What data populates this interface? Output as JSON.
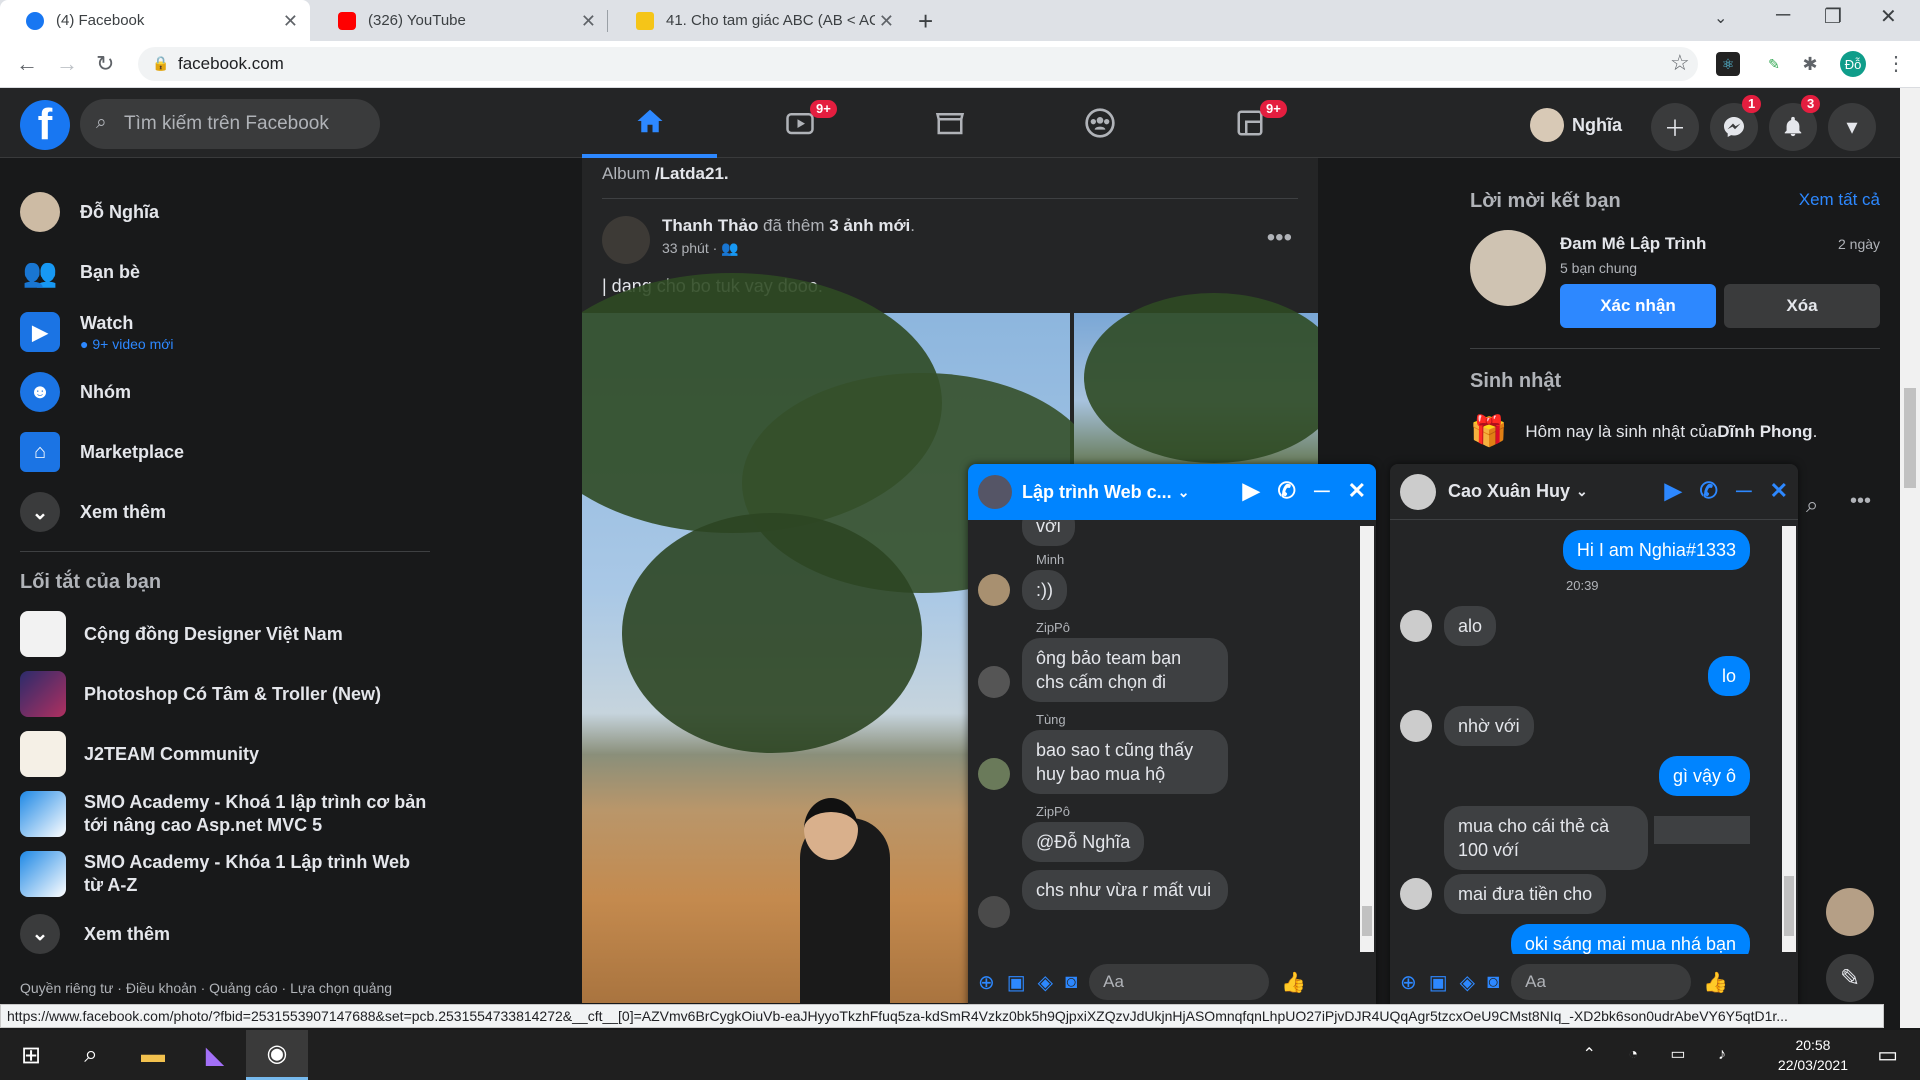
{
  "browser": {
    "tabs": [
      {
        "title": "(4) Facebook",
        "color": "#1877f2"
      },
      {
        "title": "(326) YouTube",
        "color": "#ff0000"
      },
      {
        "title": "41. Cho tam giác ABC (AB < AC)",
        "color": "#f5c518"
      }
    ],
    "url": "facebook.com",
    "profile_initials": "Đỗ"
  },
  "header": {
    "search_placeholder": "Tìm kiếm trên Facebook",
    "watch_badge": "9+",
    "gaming_badge": "9+",
    "user_name": "Nghĩa",
    "messenger_badge": "1",
    "notifications_badge": "3"
  },
  "left_nav": {
    "profile_name": "Đỗ Nghĩa",
    "items": [
      {
        "label": "Bạn bè"
      },
      {
        "label": "Watch",
        "sub": "9+ video mới"
      },
      {
        "label": "Nhóm"
      },
      {
        "label": "Marketplace"
      },
      {
        "label": "Xem thêm"
      }
    ],
    "shortcuts_heading": "Lối tắt của bạn",
    "shortcuts": [
      {
        "label": "Cộng đồng Designer Việt Nam"
      },
      {
        "label": "Photoshop Có Tâm & Troller (New)"
      },
      {
        "label": "J2TEAM Community"
      },
      {
        "label": "SMO Academy - Khoá 1 lập trình cơ bản tới nâng cao Asp.net MVC 5"
      },
      {
        "label": "SMO Academy - Khóa 1 Lập trình Web từ A-Z"
      }
    ],
    "shortcuts_more": "Xem thêm",
    "footer": "Quyền riêng tư · Điều khoản · Quảng cáo · Lựa chọn quảng"
  },
  "feed": {
    "album_prefix": "Album ",
    "album_name": "/Latda21.",
    "post_author": "Thanh Thảo",
    "post_action_pre": " đã thêm ",
    "post_action_bold": "3 ảnh mới",
    "post_action_post": ".",
    "post_time": "33 phút ·",
    "post_text": "| dang cho bo tuk vay dooo."
  },
  "right_panel": {
    "friend_requests_title": "Lời mời kết bạn",
    "see_all": "Xem tất cả",
    "request_name": "Đam Mê Lập Trình",
    "request_age": "2 ngày",
    "request_mutual": "5 bạn chung",
    "confirm_label": "Xác nhận",
    "delete_label": "Xóa",
    "birthday_title": "Sinh nhật",
    "birthday_pre": "Hôm nay là sinh nhật của ",
    "birthday_name": "Dĩnh Phong",
    "birthday_post": "."
  },
  "chat_group": {
    "title": "Lập trình Web c...",
    "messages": [
      {
        "sender": "",
        "text": "với"
      },
      {
        "sender": "Minh",
        "text": ":))"
      },
      {
        "sender": "ZipPô",
        "text": "ông bảo team bạn chs cấm chọn đi"
      },
      {
        "sender": "Tùng",
        "text": "bao sao t cũng thấy huy bao mua hộ"
      },
      {
        "sender": "ZipPô",
        "text": "@Đỗ Nghĩa"
      },
      {
        "sender": "",
        "text": "chs như vừa r mất vui"
      }
    ],
    "input_placeholder": "Aa"
  },
  "chat_dm": {
    "title": "Cao Xuân Huy",
    "messages": [
      {
        "dir": "out",
        "text": "Hi I am Nghia#1333"
      },
      {
        "dir": "time",
        "text": "20:39"
      },
      {
        "dir": "in",
        "text": "alo"
      },
      {
        "dir": "out",
        "text": "lo"
      },
      {
        "dir": "in",
        "text": "nhờ với"
      },
      {
        "dir": "out",
        "text": "gì vậy ô"
      },
      {
        "dir": "in",
        "text": "mua cho cái thẻ cà 100 vớí"
      },
      {
        "dir": "in",
        "text": "mai đưa tiền cho"
      },
      {
        "dir": "out",
        "text": "oki sáng mai mua nhá bạn"
      }
    ],
    "input_placeholder": "Aa"
  },
  "status_url": "https://www.facebook.com/photo/?fbid=2531553907147688&set=pcb.2531554733814272&__cft__[0]=AZVmv6BrCygkOiuVb-eaJHyyoTkzhFfuq5za-kdSmR4Vzkz0bk5h9QjpxiXZQzvJdUkjnHjASOmnqfqnLhpUO27iPjvDJR4UQqAgr5tzcxOeU9CMst8NIq_-XD2bk6son0udrAbeVY6Y5qtD1r...",
  "taskbar": {
    "time": "20:58",
    "date": "22/03/2021"
  },
  "colors": {
    "fb_blue": "#1877f2",
    "accent": "#2d88ff",
    "badge_red": "#e41e3f",
    "messenger_blue": "#0084ff"
  }
}
